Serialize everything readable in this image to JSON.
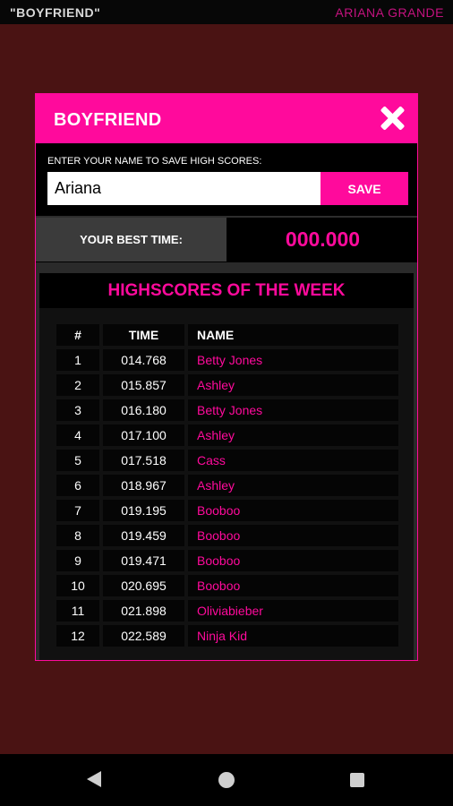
{
  "top_bar": {
    "left_title": "\"BOYFRIEND\"",
    "right_title": "ARIANA GRANDE"
  },
  "modal": {
    "title": "BOYFRIEND",
    "close_icon": "close-icon",
    "name_prompt": "ENTER YOUR NAME TO SAVE HIGH SCORES:",
    "name_value": "Ariana",
    "save_label": "SAVE",
    "best_time_label": "YOUR BEST TIME:",
    "best_time_value": "000.000",
    "highscores_title": "HIGHSCORES OF THE WEEK",
    "columns": [
      "#",
      "TIME",
      "NAME"
    ],
    "rows": [
      {
        "rank": "1",
        "time": "014.768",
        "name": "Betty Jones"
      },
      {
        "rank": "2",
        "time": "015.857",
        "name": "Ashley"
      },
      {
        "rank": "3",
        "time": "016.180",
        "name": "Betty Jones"
      },
      {
        "rank": "4",
        "time": "017.100",
        "name": "Ashley"
      },
      {
        "rank": "5",
        "time": "017.518",
        "name": "Cass"
      },
      {
        "rank": "6",
        "time": "018.967",
        "name": "Ashley"
      },
      {
        "rank": "7",
        "time": "019.195",
        "name": "Booboo"
      },
      {
        "rank": "8",
        "time": "019.459",
        "name": "Booboo"
      },
      {
        "rank": "9",
        "time": "019.471",
        "name": "Booboo"
      },
      {
        "rank": "10",
        "time": "020.695",
        "name": "Booboo"
      },
      {
        "rank": "11",
        "time": "021.898",
        "name": "Oliviabieber"
      },
      {
        "rank": "12",
        "time": "022.589",
        "name": "Ninja Kid"
      }
    ]
  },
  "nav": {
    "back_icon": "back-triangle-icon",
    "home_icon": "home-circle-icon",
    "recent_icon": "recent-apps-square-icon"
  },
  "colors": {
    "accent": "#ff0a9c",
    "background": "#4a1313",
    "panel": "#1c1c1c"
  }
}
